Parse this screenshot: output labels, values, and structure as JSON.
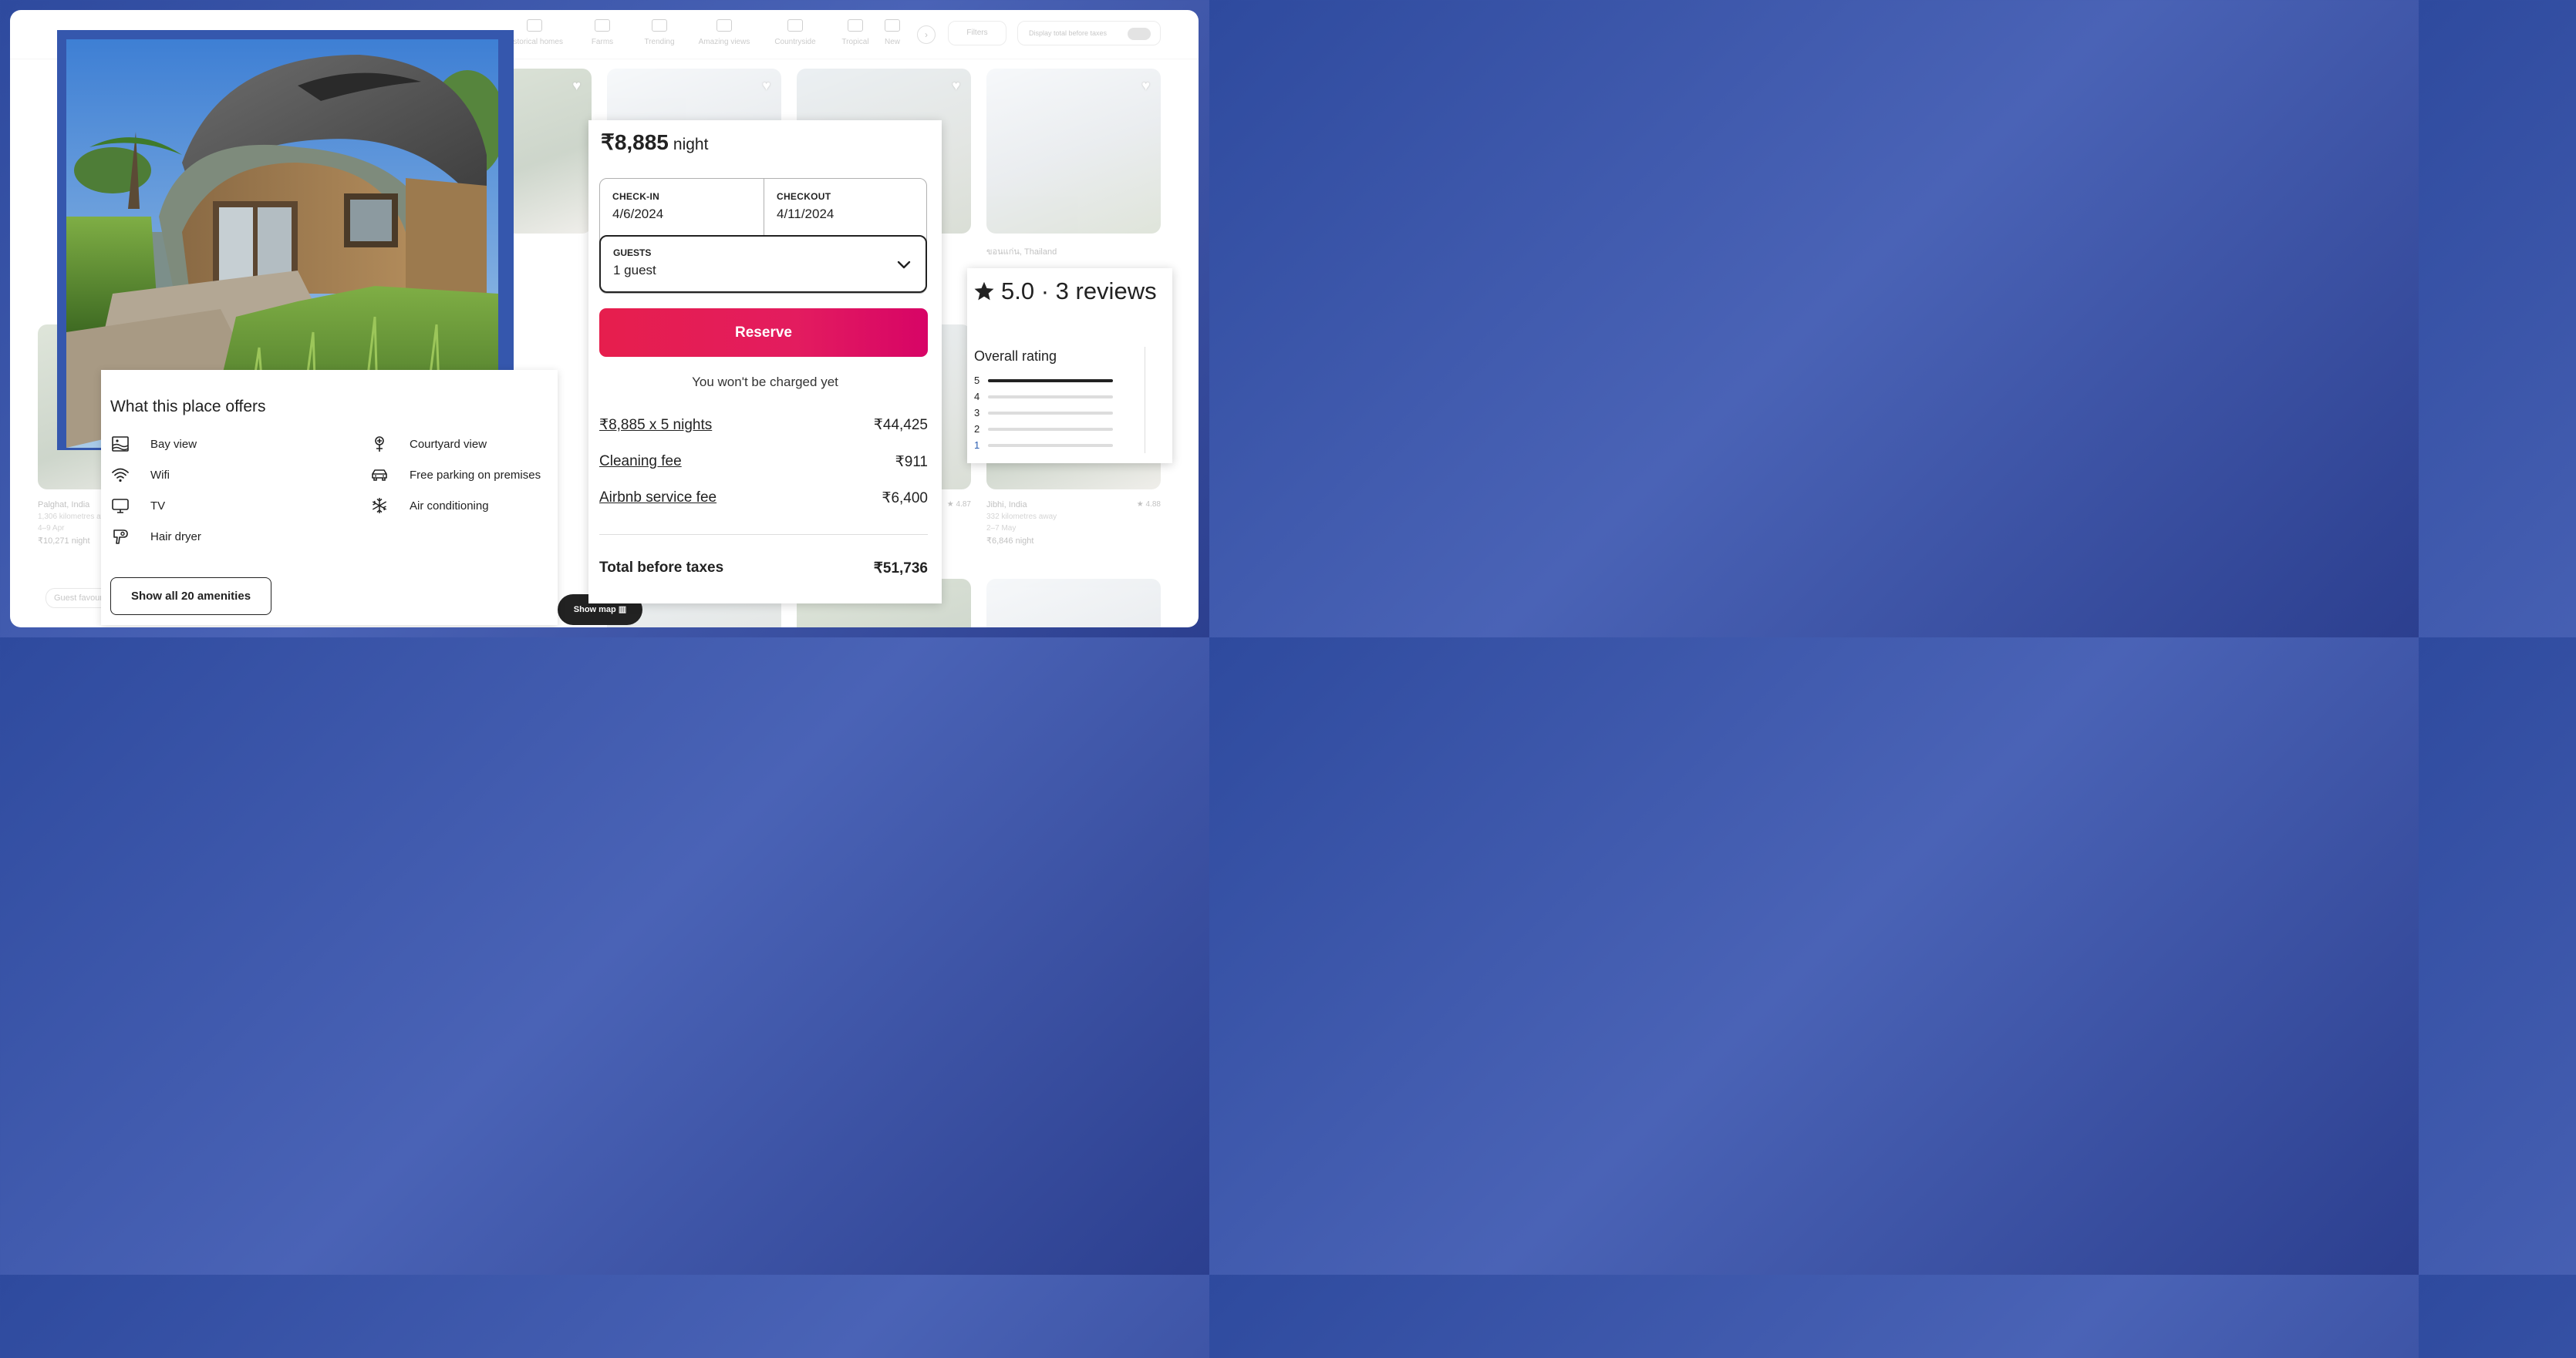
{
  "background_page": {
    "categories": [
      "Historical homes",
      "Farms",
      "Trending",
      "Amazing views",
      "Countryside",
      "Tropical",
      "New"
    ],
    "filters_label": "Filters",
    "total_toggle_label": "Display total before taxes",
    "cards": [
      {
        "loc": "Palghat, India",
        "sub": "1,306 kilometres away",
        "dates": "4–9 Apr",
        "price": "₹10,271 night"
      },
      {
        "loc": "ขอนแก่น, Thailand",
        "sub": "",
        "dates": "",
        "price": ""
      },
      {
        "loc": "Jibhi, India",
        "sub": "332 kilometres away",
        "dates": "2–7 May",
        "price": "₹6,846 night",
        "rating": "★ 4.88"
      },
      {
        "loc": "",
        "sub": "",
        "dates": "",
        "price": "",
        "rating": "★ 4.87"
      }
    ],
    "show_map_label": "Show map",
    "guest_favourite": "Guest favourite"
  },
  "amenities": {
    "title": "What this place offers",
    "items": [
      {
        "label": "Bay view",
        "icon": "bay-view-icon"
      },
      {
        "label": "Courtyard view",
        "icon": "courtyard-view-icon"
      },
      {
        "label": "Wifi",
        "icon": "wifi-icon"
      },
      {
        "label": "Free parking on premises",
        "icon": "car-icon"
      },
      {
        "label": "TV",
        "icon": "tv-icon"
      },
      {
        "label": "Air conditioning",
        "icon": "snowflake-icon"
      },
      {
        "label": "Hair dryer",
        "icon": "hair-dryer-icon"
      }
    ],
    "show_all_label": "Show all 20 amenities"
  },
  "booking": {
    "price": "₹8,885",
    "price_unit": "night",
    "checkin_label": "CHECK-IN",
    "checkin_value": "4/6/2024",
    "checkout_label": "CHECKOUT",
    "checkout_value": "4/11/2024",
    "guests_label": "GUESTS",
    "guests_value": "1 guest",
    "reserve_label": "Reserve",
    "note": "You won't be charged yet",
    "fees": [
      {
        "label": "₹8,885 x 5 nights",
        "value": "₹44,425"
      },
      {
        "label": "Cleaning fee",
        "value": "₹911"
      },
      {
        "label": "Airbnb service fee",
        "value": "₹6,400"
      }
    ],
    "total_label": "Total before taxes",
    "total_value": "₹51,736"
  },
  "rating": {
    "summary": "5.0 · 3 reviews",
    "overall_label": "Overall rating",
    "bars": [
      {
        "stars": "5",
        "fraction": 1.0
      },
      {
        "stars": "4",
        "fraction": 0.0
      },
      {
        "stars": "3",
        "fraction": 0.0
      },
      {
        "stars": "2",
        "fraction": 0.0
      },
      {
        "stars": "1",
        "fraction": 0.0
      }
    ]
  },
  "colors": {
    "accent": "#e31c5f",
    "frame_blue": "#3557ad"
  }
}
